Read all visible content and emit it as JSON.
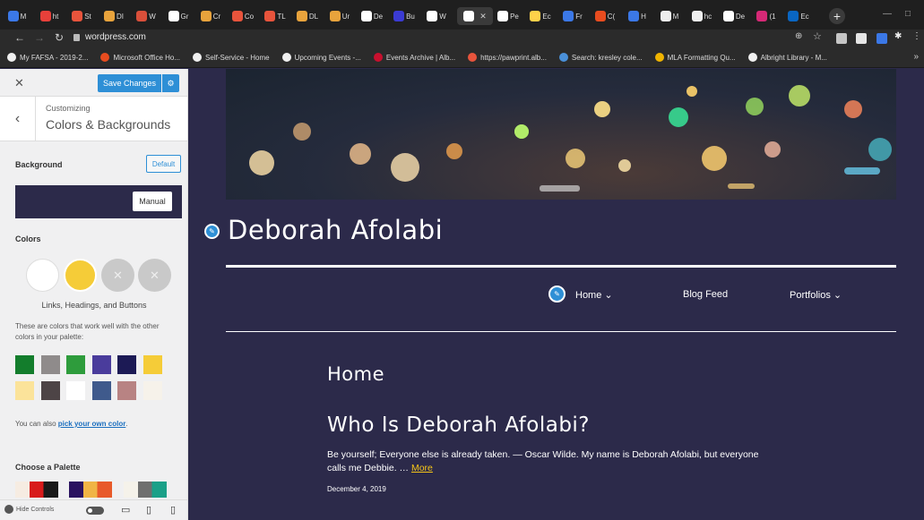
{
  "browser": {
    "url": "wordpress.com",
    "tabs": [
      "M",
      "ht",
      "St",
      "DI",
      "W",
      "Gr",
      "Cr",
      "Co",
      "TL",
      "DL",
      "Ur",
      "De",
      "Bu",
      "W",
      "",
      "Pe",
      "Ec",
      "Fr",
      "C(",
      "H",
      "M",
      "hc",
      "De",
      "(1",
      "Ec"
    ],
    "bookmarks": [
      {
        "label": "My FAFSA - 2019-2...",
        "color": "#f0f0f0"
      },
      {
        "label": "Microsoft Office Ho...",
        "color": "#e84c1f"
      },
      {
        "label": "Self-Service - Home",
        "color": "#f0f0f0"
      },
      {
        "label": "Upcoming Events -...",
        "color": "#f0f0f0"
      },
      {
        "label": "Events Archive | Alb...",
        "color": "#c8102e"
      },
      {
        "label": "https://pawprint.alb...",
        "color": "#e8543c"
      },
      {
        "label": "Search: kresley cole...",
        "color": "#4a90d9"
      },
      {
        "label": "MLA Formatting Qu...",
        "color": "#f0b400"
      },
      {
        "label": "Albright Library - M...",
        "color": "#f0f0f0"
      }
    ]
  },
  "sidebar": {
    "save_label": "Save Changes",
    "breadcrumb": "Customizing",
    "heading": "Colors & Backgrounds",
    "background_label": "Background",
    "default_label": "Default",
    "manual_label": "Manual",
    "colors_label": "Colors",
    "circles_label": "Links, Headings, and Buttons",
    "palette_hint": "These are colors that work well with the other colors in your palette:",
    "pick_prefix": "You can also ",
    "pick_link": "pick your own color",
    "pick_suffix": ".",
    "choose_palette": "Choose a Palette",
    "hide_controls": "Hide Controls",
    "swatches_row1": [
      "#137d2c",
      "#8f8b8b",
      "#2e9c3c",
      "#4a3c9c",
      "#1c1a55",
      "#f5cc38"
    ],
    "swatches_row2": [
      "#fbe39a",
      "#4d4446",
      "#ffffff",
      "#3f5a8c",
      "#b88383",
      "#f6f2ea"
    ],
    "background_color": "#2c2a4a",
    "accent_color": "#f5cc38"
  },
  "site": {
    "title": "Deborah Afolabi",
    "menu": [
      "Home ⌄",
      "Blog Feed",
      "Portfolios ⌄"
    ],
    "page_heading": "Home",
    "post_title": "Who Is Deborah Afolabi?",
    "excerpt": "Be yourself; Everyone else is already taken. — Oscar Wilde. My name is Deborah Afolabi, but everyone calls me Debbie. … ",
    "more_label": "More",
    "date": "December 4, 2019"
  }
}
